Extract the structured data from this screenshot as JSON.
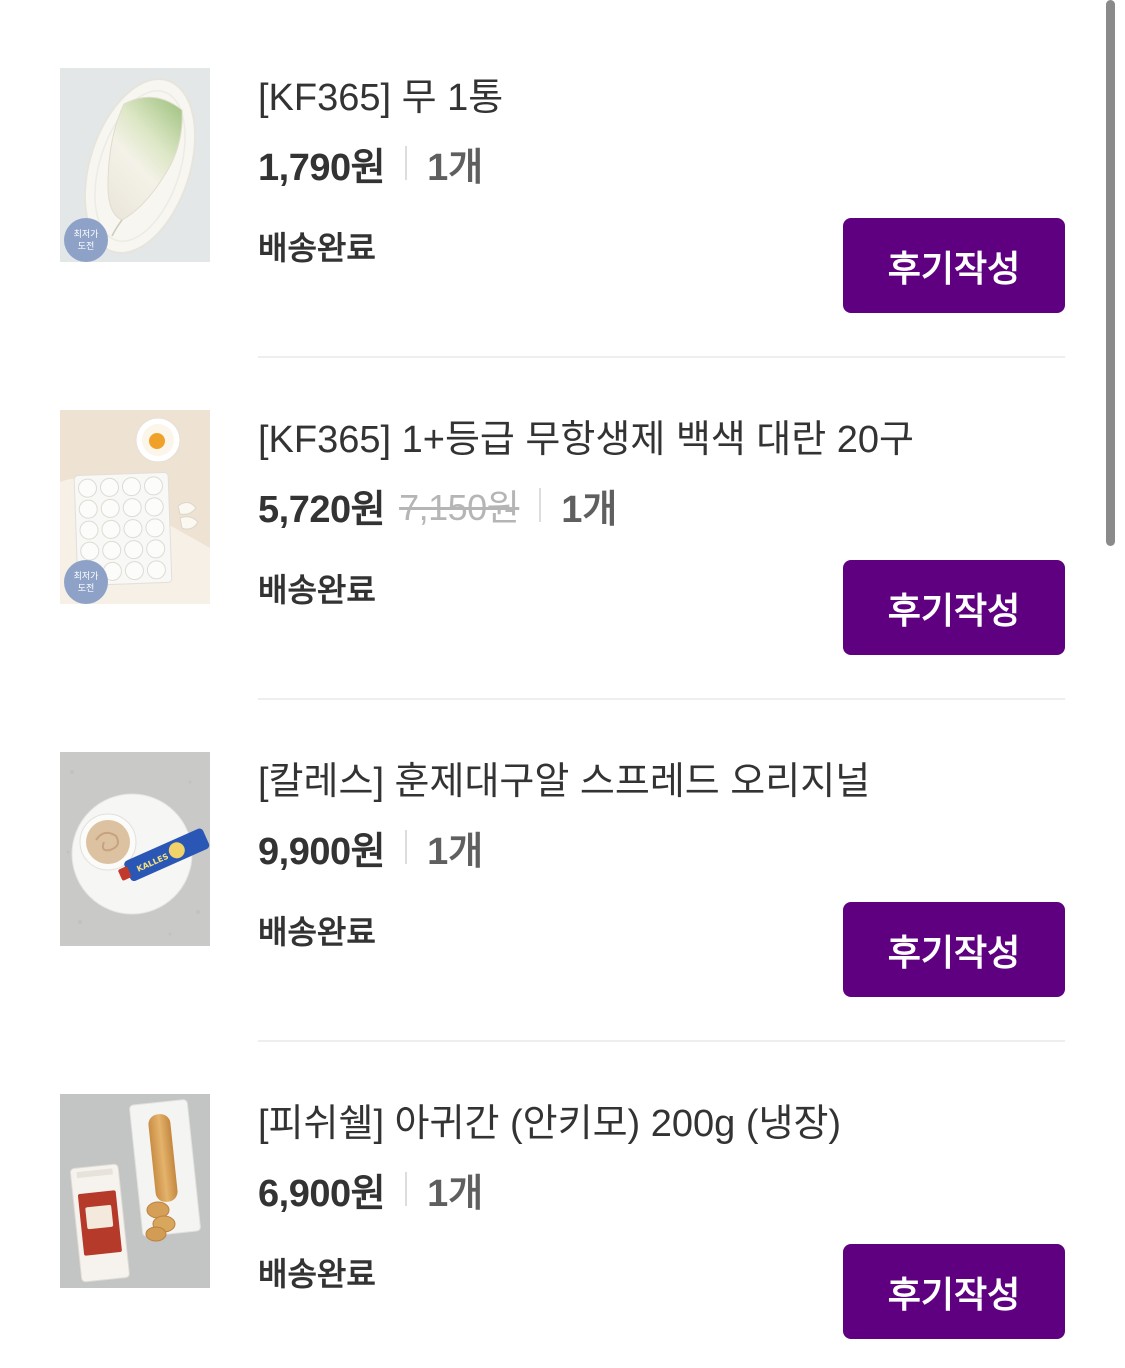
{
  "colors": {
    "accent": "#5f0080",
    "text": "#333333",
    "muted": "#b5b5b5",
    "divider": "#eeeeee",
    "scrollbar": "#8a8a8a"
  },
  "orders": [
    {
      "title": "[KF365] 무 1통",
      "price": "1,790원",
      "quantity": "1개",
      "status": "배송완료",
      "review_button": "후기작성",
      "badge": {
        "line1": "최저가",
        "line2": "도전"
      },
      "image": "radish-image"
    },
    {
      "title": "[KF365] 1+등급 무항생제 백색 대란 20구",
      "price": "5,720원",
      "original_price": "7,150원",
      "quantity": "1개",
      "status": "배송완료",
      "review_button": "후기작성",
      "badge": {
        "line1": "최저가",
        "line2": "도전"
      },
      "image": "eggs-image"
    },
    {
      "title": "[칼레스] 훈제대구알 스프레드 오리지널",
      "price": "9,900원",
      "quantity": "1개",
      "status": "배송완료",
      "review_button": "후기작성",
      "package_logo": "KALLES",
      "image": "cod-roe-spread-image"
    },
    {
      "title": "[피쉬쉘] 아귀간 (안키모) 200g (냉장)",
      "price": "6,900원",
      "quantity": "1개",
      "status": "배송완료",
      "review_button": "후기작성",
      "image": "monkfish-liver-image"
    }
  ]
}
